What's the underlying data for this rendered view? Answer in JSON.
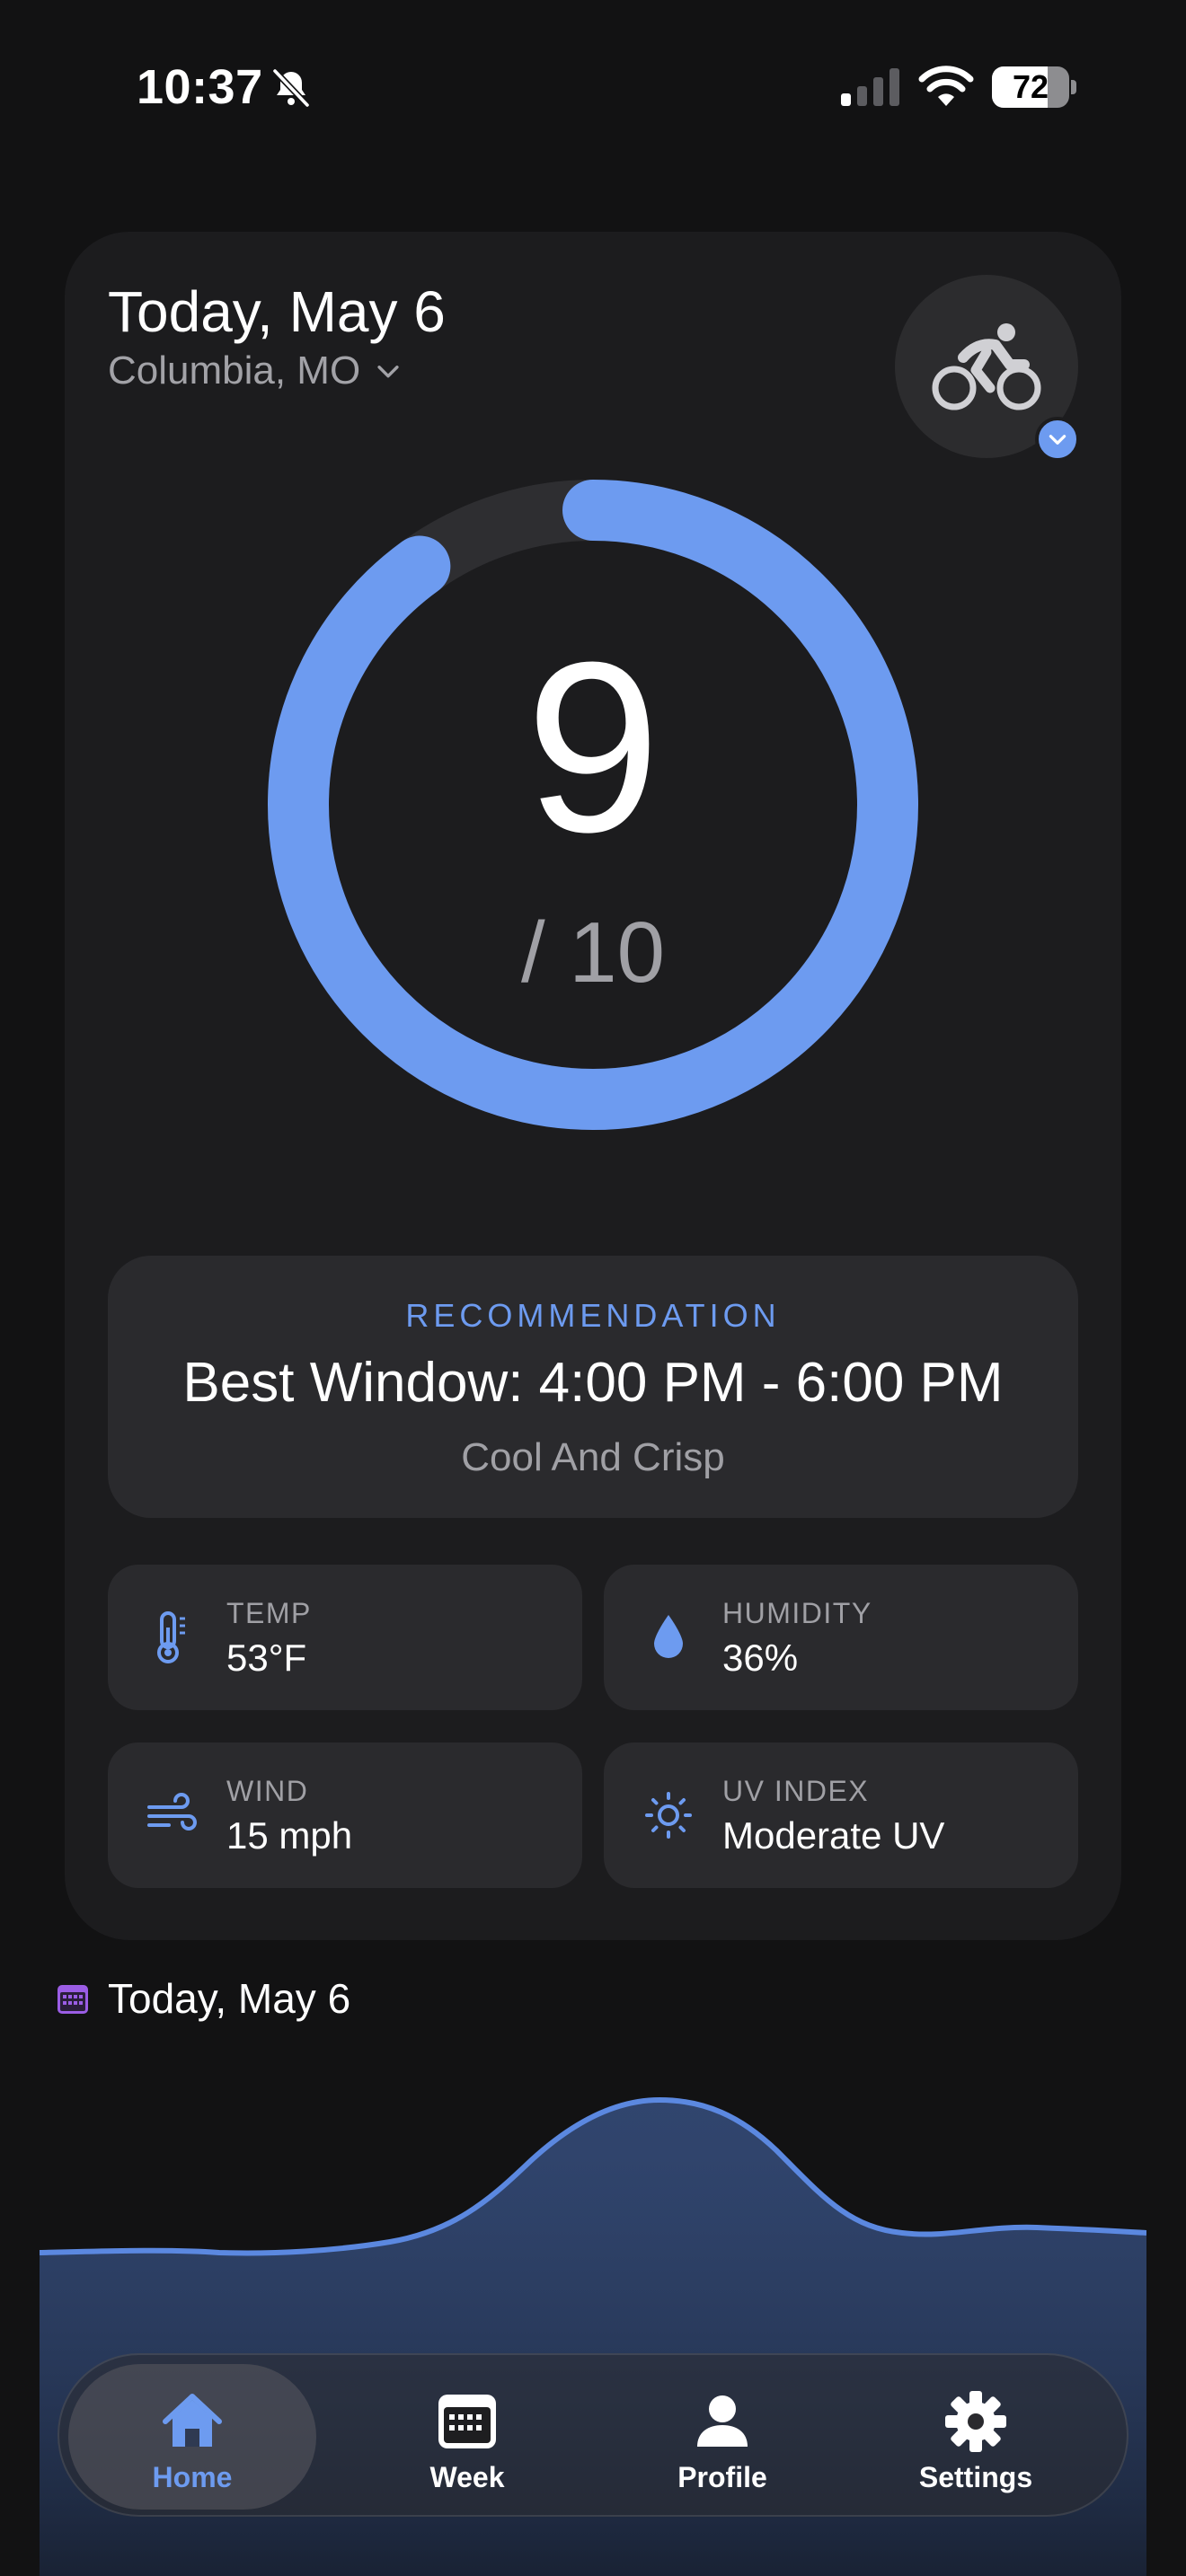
{
  "status_bar": {
    "time": "10:37",
    "battery_level": 72,
    "battery_text": "72",
    "icons": [
      "bell-slash-icon",
      "cellular-signal-icon",
      "wifi-icon",
      "battery-icon"
    ]
  },
  "card": {
    "date": "Today, May 6",
    "location": "Columbia, MO",
    "activity_icon": "bicycle-icon"
  },
  "score": {
    "value": "9",
    "max_text": "/ 10",
    "fraction": 0.9
  },
  "recommendation": {
    "label": "RECOMMENDATION",
    "window": "Best Window: 4:00 PM - 6:00 PM",
    "description": "Cool And Crisp"
  },
  "metrics": [
    {
      "label": "TEMP",
      "value": "53°F",
      "icon": "thermometer-icon"
    },
    {
      "label": "HUMIDITY",
      "value": "36%",
      "icon": "water-drop-icon"
    },
    {
      "label": "WIND",
      "value": "15 mph",
      "icon": "wind-icon"
    },
    {
      "label": "UV INDEX",
      "value": "Moderate UV",
      "icon": "sun-icon"
    }
  ],
  "day_section": {
    "title": "Today, May 6",
    "icon": "calendar-icon"
  },
  "tabs": [
    {
      "label": "Home",
      "icon": "home-icon",
      "active": true
    },
    {
      "label": "Week",
      "icon": "calendar-icon",
      "active": false
    },
    {
      "label": "Profile",
      "icon": "person-icon",
      "active": false
    },
    {
      "label": "Settings",
      "icon": "gear-icon",
      "active": false
    }
  ],
  "colors": {
    "background": "#121213",
    "card": "#1c1c1e",
    "tile": "#2a2a2d",
    "accent": "#6d9bf0",
    "muted_text": "#a0a0a5",
    "calendar_accent": "#9b5de5"
  }
}
